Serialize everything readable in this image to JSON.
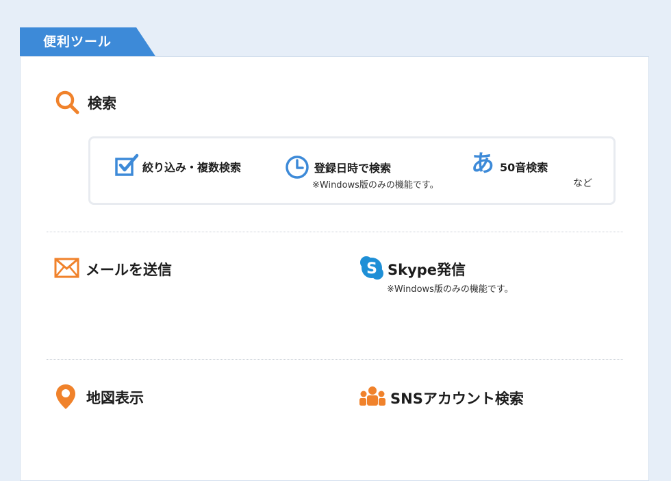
{
  "tab": {
    "label": "便利ツール"
  },
  "search_section": {
    "heading": "検索",
    "features": [
      {
        "label": "絞り込み・複数検索"
      },
      {
        "label": "登録日時で検索",
        "note": "※Windows版のみの機能です。"
      },
      {
        "label": "50音検索",
        "icon_char": "あ"
      }
    ],
    "etc": "など"
  },
  "mail_section": {
    "heading": "メールを送信"
  },
  "skype_section": {
    "heading": "Skype発信",
    "note": "※Windows版のみの機能です。"
  },
  "map_section": {
    "heading": "地図表示"
  },
  "sns_section": {
    "heading": "SNSアカウント検索"
  },
  "colors": {
    "accent_blue": "#3d8ad8",
    "accent_orange": "#f0822b",
    "skype_blue": "#1e8fd6"
  }
}
